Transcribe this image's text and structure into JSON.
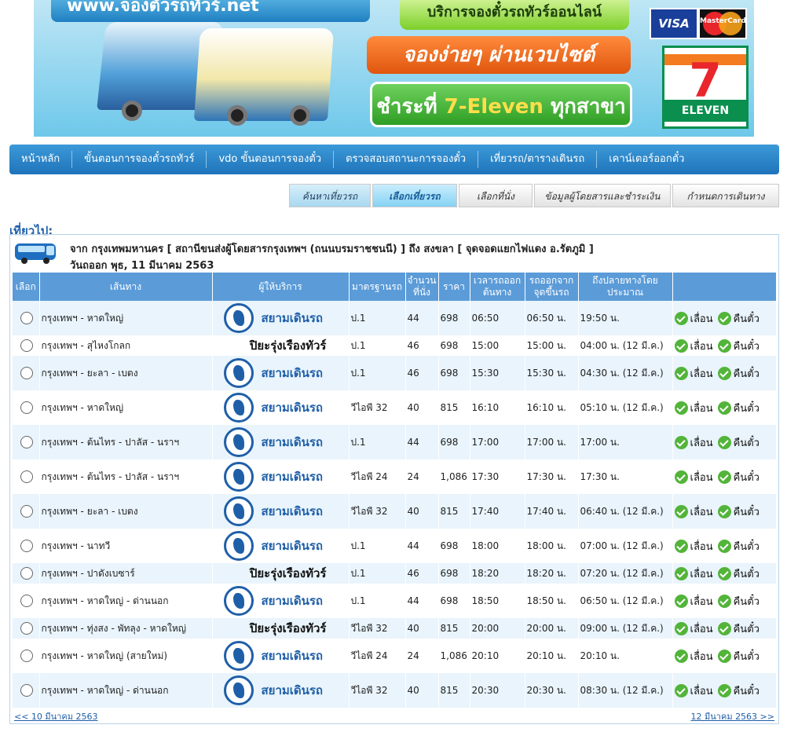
{
  "banner": {
    "domain_text": "www.จองตั๋วรถทัวร์.net",
    "service_text": "บริการจองตั๋วรถทัวร์ออนไลน์",
    "easy_text": "จองง่ายๆ ผ่านเวบไซต์",
    "pay_prefix": "ชำระที่",
    "pay_brand": "7-Eleven",
    "pay_suffix": "ทุกสาขา",
    "visa_text": "VISA",
    "mastercard_text": "MasterCard",
    "seven_number": "7",
    "seven_text": "ELEVEN"
  },
  "nav": {
    "items": [
      {
        "label": "หน้าหลัก"
      },
      {
        "label": "ขั้นตอนการจองตั๋วรถทัวร์"
      },
      {
        "label": "vdo ขั้นตอนการจองตั๋ว"
      },
      {
        "label": "ตรวจสอบสถานะการจองตั๋ว"
      },
      {
        "label": "เที่ยวรถ/ตารางเดินรถ"
      },
      {
        "label": "เคาน์เตอร์ออกตั๋ว"
      }
    ]
  },
  "steps": [
    "ค้นหาเที่ยวรถ",
    "เลือกเที่ยวรถ",
    "เลือกที่นั่ง",
    "ข้อมูลผู้โดยสารและชำระเงิน",
    "กำหนดการเดินทาง"
  ],
  "trip": {
    "title": "เที่ยวไป:",
    "route": "จาก กรุงเทพมหานคร [ สถานีขนส่งผู้โดยสารกรุงเทพฯ (ถนนบรมราชชนนี) ] ถึง สงขลา [ จุดจอดแยกไฟแดง อ.รัตภูมิ ]",
    "date": "วันถออก พุธ, 11 มีนาคม 2563"
  },
  "table": {
    "headers": {
      "select": "เลือก",
      "route": "เส้นทาง",
      "operator": "ผู้ให้บริการ",
      "standard": "มาตรฐานรถ",
      "seats": "จำนวนที่นั่ง",
      "price": "ราคา",
      "depart": "เวลารถออกต้นทาง",
      "board": "รถออกจากจุดขึ้นรถ",
      "arrive": "ถึงปลายทางโดยประมาณ"
    },
    "siam_name": "สยามเดินรถ",
    "piya_name": "ปิยะรุ่งเรืองทัวร์",
    "btn_seat": "เลื่อน",
    "btn_refund": "คืนตั๋ว",
    "rows": [
      {
        "route": "กรุงเทพฯ - หาดใหญ่",
        "op": "siam",
        "std": "ป.1",
        "seats": "44",
        "price": "698",
        "dep": "06:50",
        "board": "06:50 น.",
        "arr": "19:50 น."
      },
      {
        "route": "กรุงเทพฯ - สุไหงโกลก",
        "op": "piya",
        "std": "ป.1",
        "seats": "46",
        "price": "698",
        "dep": "15:00",
        "board": "15:00 น.",
        "arr": "04:00 น. (12 มี.ค.)"
      },
      {
        "route": "กรุงเทพฯ - ยะลา - เบตง",
        "op": "siam",
        "std": "ป.1",
        "seats": "46",
        "price": "698",
        "dep": "15:30",
        "board": "15:30 น.",
        "arr": "04:30 น. (12 มี.ค.)"
      },
      {
        "route": "กรุงเทพฯ - หาดใหญ่",
        "op": "siam",
        "std": "วีไอพี 32",
        "seats": "40",
        "price": "815",
        "dep": "16:10",
        "board": "16:10 น.",
        "arr": "05:10 น. (12 มี.ค.)"
      },
      {
        "route": "กรุงเทพฯ - ต้นไทร - ปาลัส - นราฯ",
        "op": "siam",
        "std": "ป.1",
        "seats": "44",
        "price": "698",
        "dep": "17:00",
        "board": "17:00 น.",
        "arr": "17:00 น."
      },
      {
        "route": "กรุงเทพฯ - ต้นไทร - ปาลัส - นราฯ",
        "op": "siam",
        "std": "วีไอพี 24",
        "seats": "24",
        "price": "1,086",
        "dep": "17:30",
        "board": "17:30 น.",
        "arr": "17:30 น."
      },
      {
        "route": "กรุงเทพฯ - ยะลา - เบตง",
        "op": "siam",
        "std": "วีไอพี 32",
        "seats": "40",
        "price": "815",
        "dep": "17:40",
        "board": "17:40 น.",
        "arr": "06:40 น. (12 มี.ค.)"
      },
      {
        "route": "กรุงเทพฯ - นาทวี",
        "op": "siam",
        "std": "ป.1",
        "seats": "44",
        "price": "698",
        "dep": "18:00",
        "board": "18:00 น.",
        "arr": "07:00 น. (12 มี.ค.)"
      },
      {
        "route": "กรุงเทพฯ - ปาดังเบซาร์",
        "op": "piya",
        "std": "ป.1",
        "seats": "46",
        "price": "698",
        "dep": "18:20",
        "board": "18:20 น.",
        "arr": "07:20 น. (12 มี.ค.)"
      },
      {
        "route": "กรุงเทพฯ - หาดใหญ่ - ด่านนอก",
        "op": "siam",
        "std": "ป.1",
        "seats": "44",
        "price": "698",
        "dep": "18:50",
        "board": "18:50 น.",
        "arr": "06:50 น. (12 มี.ค.)"
      },
      {
        "route": "กรุงเทพฯ - ทุ่งสง - พัทลุง - หาดใหญ่",
        "op": "piya",
        "std": "วีไอพี 32",
        "seats": "40",
        "price": "815",
        "dep": "20:00",
        "board": "20:00 น.",
        "arr": "09:00 น. (12 มี.ค.)"
      },
      {
        "route": "กรุงเทพฯ - หาดใหญ่ (สายใหม่)",
        "op": "siam",
        "std": "วีไอพี 24",
        "seats": "24",
        "price": "1,086",
        "dep": "20:10",
        "board": "20:10 น.",
        "arr": "20:10 น."
      },
      {
        "route": "กรุงเทพฯ - หาดใหญ่ - ด่านนอก",
        "op": "siam",
        "std": "วีไอพี 32",
        "seats": "40",
        "price": "815",
        "dep": "20:30",
        "board": "20:30 น.",
        "arr": "08:30 น. (12 มี.ค.)"
      }
    ]
  },
  "pager": {
    "prev": "<< 10 มีนาคม 2563",
    "next": "12 มีนาคม 2563 >>"
  }
}
